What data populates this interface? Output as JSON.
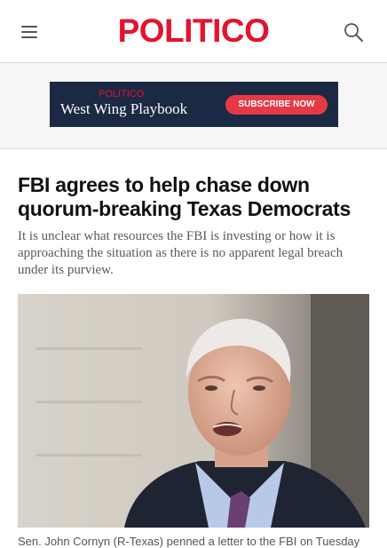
{
  "header": {
    "logo_text": "POLITICO",
    "menu_icon": "hamburger-menu-icon",
    "search_icon": "search-icon",
    "brand_color": "#e2142d"
  },
  "ad": {
    "brand": "POLITICO",
    "title": "West Wing Playbook",
    "cta": "SUBSCRIBE NOW",
    "background": "#1b2944",
    "cta_color": "#e63946"
  },
  "article": {
    "headline": "FBI agrees to help chase down quorum-breaking Texas Democrats",
    "dek": "It is unclear what resources the FBI is investing or how it is approaching the situation as there is no apparent legal breach under its purview.",
    "caption": "Sen. John Cornyn (R-Texas) penned a letter to the FBI on Tuesday"
  }
}
